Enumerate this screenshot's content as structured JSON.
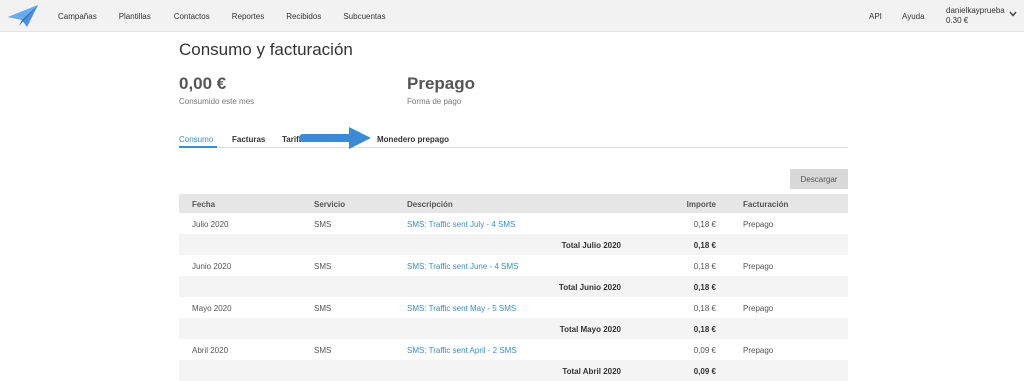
{
  "nav": {
    "items": [
      "Campañas",
      "Plantillas",
      "Contactos",
      "Reportes",
      "Recibidos",
      "Subcuentas"
    ],
    "api": "API",
    "help": "Ayuda",
    "account_name": "danielkayprueba",
    "account_balance": "0.30 €"
  },
  "page": {
    "title": "Consumo y facturación",
    "consumed_value": "0,00 €",
    "consumed_label": "Consumido este mes",
    "payment_value": "Prepago",
    "payment_label": "Forma de pago"
  },
  "tabs": [
    "Consumo",
    "Facturas",
    "Tarifas",
    "Monedero prepago"
  ],
  "download_label": "Descargar",
  "table": {
    "headers": {
      "date": "Fecha",
      "service": "Servicio",
      "description": "Descripción",
      "amount": "Importe",
      "billing": "Facturación"
    },
    "months": [
      {
        "date": "Julio 2020",
        "service": "SMS",
        "description": "SMS: Traffic sent July - 4 SMS",
        "amount": "0,18 €",
        "billing": "Prepago",
        "total_label": "Total Julio 2020",
        "total_amount": "0,18 €"
      },
      {
        "date": "Junio 2020",
        "service": "SMS",
        "description": "SMS: Traffic sent June - 4 SMS",
        "amount": "0,18 €",
        "billing": "Prepago",
        "total_label": "Total Junio 2020",
        "total_amount": "0,18 €"
      },
      {
        "date": "Mayo 2020",
        "service": "SMS",
        "description": "SMS: Traffic sent May - 5 SMS",
        "amount": "0,18 €",
        "billing": "Prepago",
        "total_label": "Total Mayo 2020",
        "total_amount": "0,18 €"
      },
      {
        "date": "Abril 2020",
        "service": "SMS",
        "description": "SMS: Traffic sent April - 2 SMS",
        "amount": "0,09 €",
        "billing": "Prepago",
        "total_label": "Total Abril 2020",
        "total_amount": "0,09 €"
      }
    ]
  },
  "colors": {
    "accent": "#3a8fc8",
    "arrow": "#3c8ad3",
    "logo": "#4a90e2"
  }
}
